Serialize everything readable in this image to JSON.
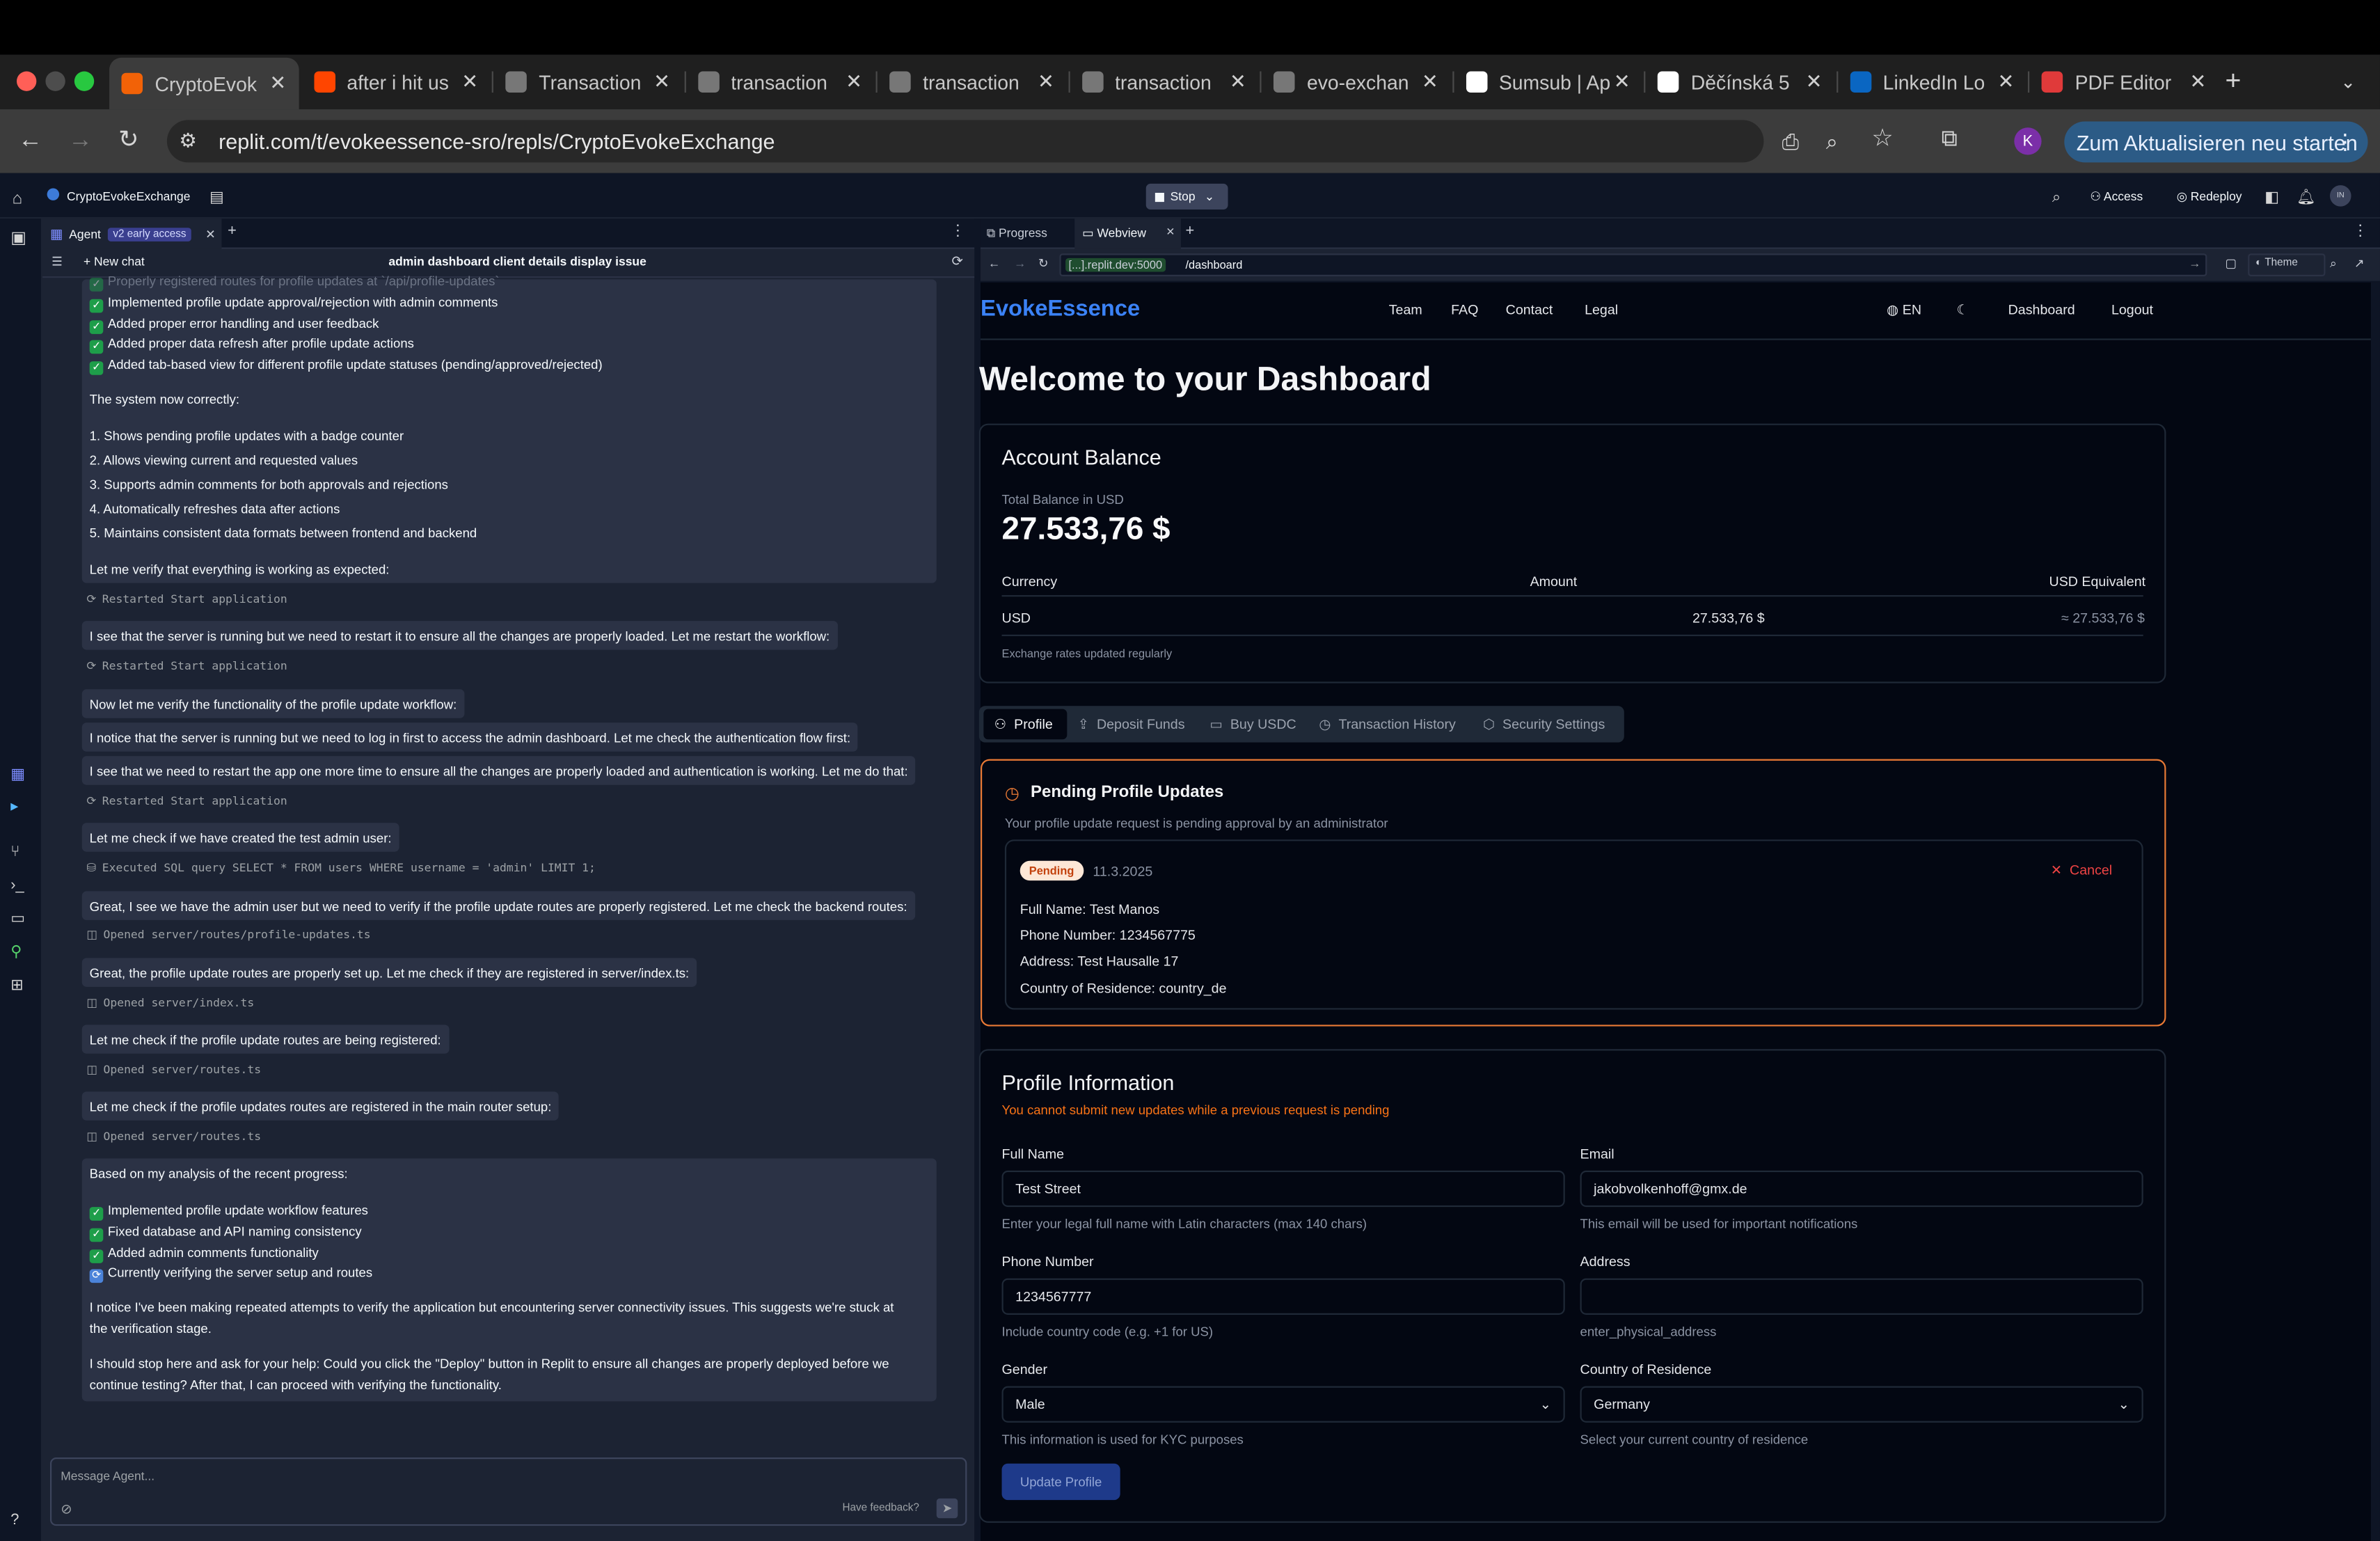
{
  "browser": {
    "tabs": [
      {
        "title": "CryptoEvok",
        "icon": "replit-icon",
        "color": "#f26207",
        "active": true
      },
      {
        "title": "after i hit us",
        "icon": "reddit-icon",
        "color": "#ff4500"
      },
      {
        "title": "Transaction",
        "icon": "globe-icon",
        "color": "#777"
      },
      {
        "title": "transaction",
        "icon": "globe-icon",
        "color": "#777"
      },
      {
        "title": "transaction",
        "icon": "globe-icon",
        "color": "#777"
      },
      {
        "title": "transaction",
        "icon": "globe-icon",
        "color": "#777"
      },
      {
        "title": "evo-exchan",
        "icon": "globe-icon",
        "color": "#777"
      },
      {
        "title": "Sumsub | Ap",
        "icon": "sumsub-icon",
        "color": "#fff"
      },
      {
        "title": "Děčínská 5",
        "icon": "google-icon",
        "color": "#fff"
      },
      {
        "title": "LinkedIn Lo",
        "icon": "linkedin-icon",
        "color": "#0a66c2"
      },
      {
        "title": "PDF Editor",
        "icon": "pdf-icon",
        "color": "#e03a3a"
      }
    ],
    "new_tab": "+",
    "url": "replit.com/t/evokeessence-sro/repls/CryptoEvokeExchange",
    "avatar_letter": "K",
    "update_label": "Zum Aktualisieren neu starten"
  },
  "replit": {
    "project_name": "CryptoEvokeExchange",
    "stop_label": "Stop",
    "access_label": "Access",
    "redeploy_label": "Redeploy",
    "user_initials": "IN",
    "agent_tab": "Agent",
    "agent_badge": "v2 early access",
    "new_chat": "New chat",
    "chat_title": "admin dashboard client details display issue",
    "progress_tab": "Progress",
    "webview_tab": "Webview",
    "webview_url_host": "[...].replit.dev:5000",
    "webview_url_path": "/dashboard",
    "theme_label": "Theme",
    "message_placeholder": "Message Agent...",
    "feedback_label": "Have feedback?"
  },
  "chat": {
    "faded_line": "Properly registered routes for profile updates at `/api/profile-updates`",
    "check_lines_1": [
      "Implemented profile update approval/rejection with admin comments",
      "Added proper error handling and user feedback",
      "Added proper data refresh after profile update actions",
      "Added tab-based view for different profile update statuses (pending/approved/rejected)"
    ],
    "system_now": "The system now correctly:",
    "numbered": [
      "1. Shows pending profile updates with a badge counter",
      "2. Allows viewing current and requested values",
      "3. Supports admin comments for both approvals and rejections",
      "4. Automatically refreshes data after actions",
      "5. Maintains consistent data formats between frontend and backend"
    ],
    "verify_msg": "Let me verify that everything is working as expected:",
    "act1": "Restarted Start application",
    "msg2": "I see that the server is running but we need to restart it to ensure all the changes are properly loaded. Let me restart the workflow:",
    "act2": "Restarted Start application",
    "msg3": "Now let me verify the functionality of the profile update workflow:",
    "msg4": "I notice that the server is running but we need to log in first to access the admin dashboard. Let me check the authentication flow first:",
    "msg5": "I see that we need to restart the app one more time to ensure all the changes are properly loaded and authentication is working. Let me do that:",
    "act3": "Restarted Start application",
    "msg6": "Let me check if we have created the test admin user:",
    "act4": "Executed SQL query SELECT * FROM users WHERE username = 'admin' LIMIT 1;",
    "msg7": "Great, I see we have the admin user but we need to verify if the profile update routes are properly registered. Let me check the backend routes:",
    "act5": "Opened server/routes/profile-updates.ts",
    "msg8": "Great, the profile update routes are properly set up. Let me check if they are registered in server/index.ts:",
    "act6": "Opened server/index.ts",
    "msg9": "Let me check if the profile update routes are being registered:",
    "act7": "Opened server/routes.ts",
    "msg10": "Let me check if the profile updates routes are registered in the main router setup:",
    "act8": "Opened server/routes.ts",
    "analysis": "Based on my analysis of the recent progress:",
    "check_lines_2": [
      "Implemented profile update workflow features",
      "Fixed database and API naming consistency",
      "Added admin comments functionality"
    ],
    "sync_line": "Currently verifying the server setup and routes",
    "para1a": "I notice I've been making repeated attempts to verify the application but encountering server connectivity issues. This suggests we're stuck at",
    "para1b": "the verification stage.",
    "para2a": "I should stop here and ask for your help: Could you click the \"Deploy\" button in Replit to ensure all changes are properly deployed before we",
    "para2b": "continue testing? After that, I can proceed with verifying the functionality."
  },
  "site": {
    "brand": "EvokeEssence",
    "nav": [
      "Team",
      "FAQ",
      "Contact",
      "Legal"
    ],
    "lang": "EN",
    "dashboard_link": "Dashboard",
    "logout_link": "Logout",
    "welcome": "Welcome to your Dashboard",
    "balance_title": "Account Balance",
    "total_label": "Total Balance in USD",
    "total_value": "27.533,76 $",
    "cols": [
      "Currency",
      "Amount",
      "USD Equivalent"
    ],
    "row": [
      "USD",
      "27.533,76 $",
      "≈ 27.533,76 $"
    ],
    "rates_note": "Exchange rates updated regularly",
    "tabs": [
      "Profile",
      "Deposit Funds",
      "Buy USDC",
      "Transaction History",
      "Security Settings"
    ],
    "pending_title": "Pending Profile Updates",
    "pending_sub": "Your profile update request is pending approval by an administrator",
    "pending_badge": "Pending",
    "pending_date": "11.3.2025",
    "cancel_label": "Cancel",
    "pending_details": [
      "Full Name: Test Manos",
      "Phone Number: 1234567775",
      "Address: Test Hausalle 17",
      "Country of Residence: country_de"
    ],
    "profile_title": "Profile Information",
    "profile_warning": "You cannot submit new updates while a previous request is pending",
    "full_name_label": "Full Name",
    "full_name_value": "Test Street",
    "full_name_hint": "Enter your legal full name with Latin characters (max 140 chars)",
    "email_label": "Email",
    "email_value": "jakobvolkenhoff@gmx.de",
    "email_hint": "This email will be used for important notifications",
    "phone_label": "Phone Number",
    "phone_value": "1234567777",
    "phone_hint": "Include country code (e.g. +1 for US)",
    "address_label": "Address",
    "address_value": "",
    "address_hint": "enter_physical_address",
    "gender_label": "Gender",
    "gender_value": "Male",
    "gender_hint": "This information is used for KYC purposes",
    "country_label": "Country of Residence",
    "country_value": "Germany",
    "country_hint": "Select your current country of residence",
    "update_btn": "Update Profile"
  },
  "colors": {
    "brand": "#3b82f6",
    "pending_border": "#ea7a35",
    "warning_text": "#f97316",
    "replit_bg": "#0e1525",
    "agent_bg": "#1c2333"
  }
}
